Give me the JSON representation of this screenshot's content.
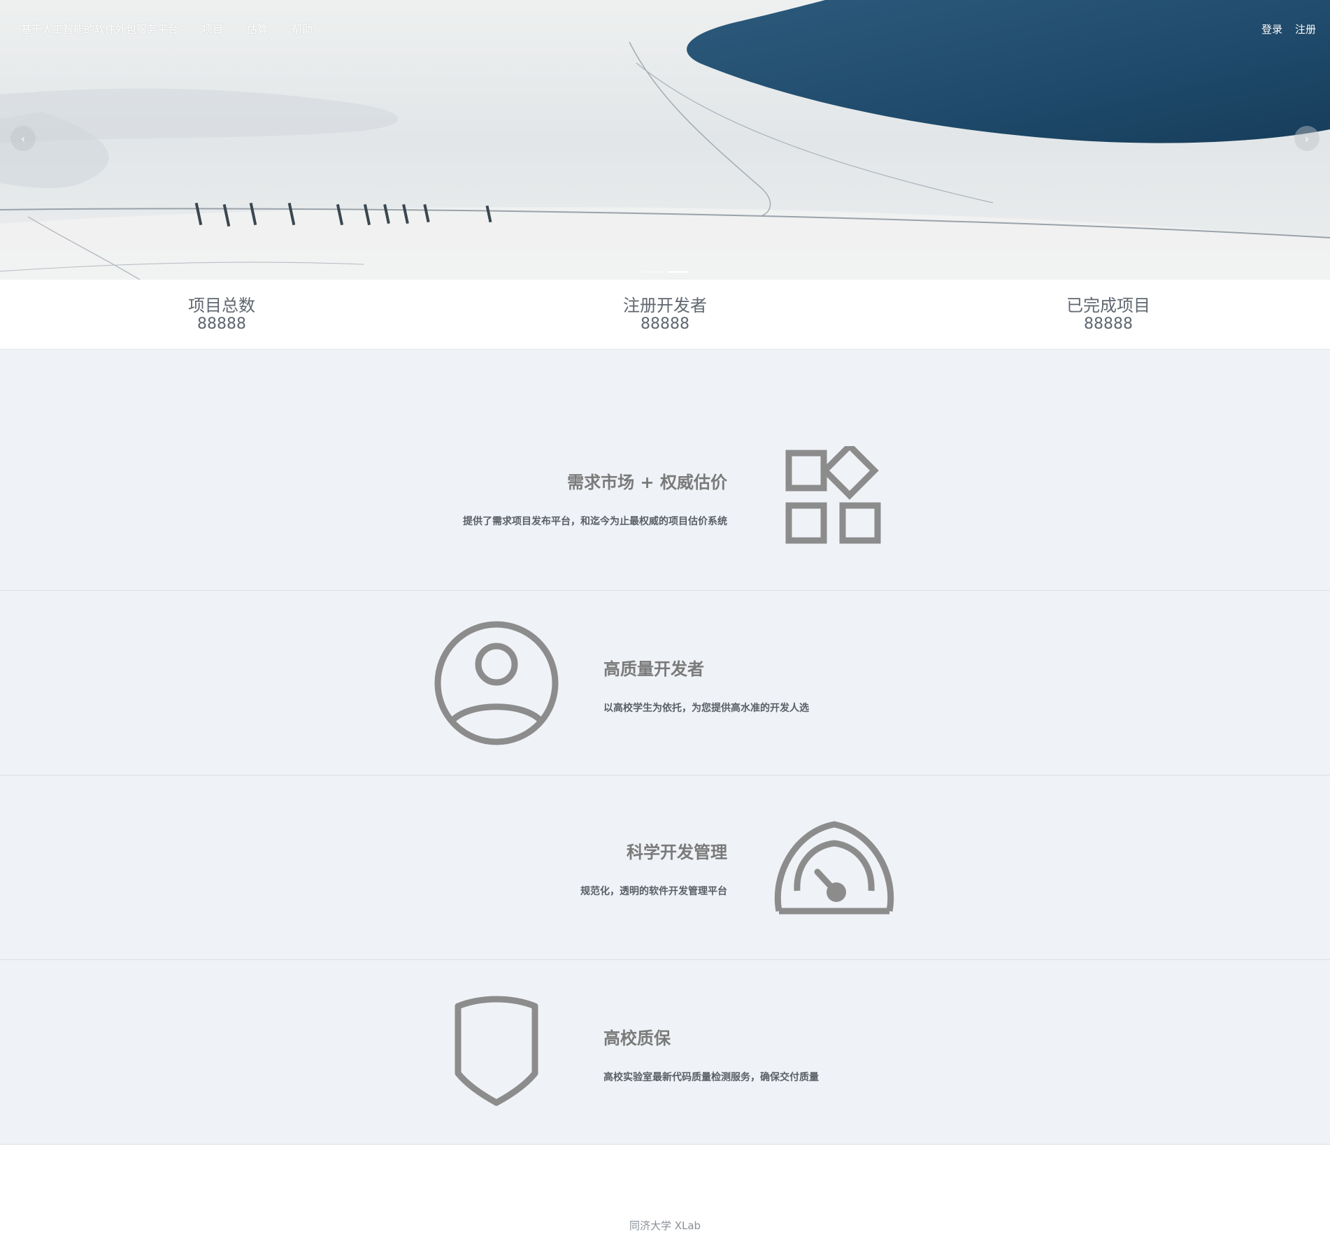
{
  "nav": {
    "brand": "基于人工智能的软件外包服务平台",
    "links": [
      "项目",
      "估算",
      "帮助"
    ],
    "login": "登录",
    "register": "注册"
  },
  "carousel": {
    "prev_symbol": "‹",
    "next_symbol": "›",
    "slide_count": 2,
    "active_index": 1
  },
  "stats": [
    {
      "label": "项目总数",
      "value": "88888"
    },
    {
      "label": "注册开发者",
      "value": "88888"
    },
    {
      "label": "已完成项目",
      "value": "88888"
    }
  ],
  "features": [
    {
      "title": "需求市场 + 权威估价",
      "desc": "提供了需求项目发布平台，和迄今为止最权威的项目估价系统",
      "icon": "apps-icon"
    },
    {
      "title": "高质量开发者",
      "desc": "以高校学生为依托，为您提供高水准的开发人选",
      "icon": "user-circle-icon"
    },
    {
      "title": "科学开发管理",
      "desc": "规范化，透明的软件开发管理平台",
      "icon": "dashboard-icon"
    },
    {
      "title": "高校质保",
      "desc": "高校实验室最新代码质量检测服务，确保交付质量",
      "icon": "shield-icon"
    }
  ],
  "footer": {
    "text": "同济大学 XLab"
  },
  "colors": {
    "feature_bg": "#eff2f6",
    "icon_gray": "#8c8c8c",
    "water_dark": "#1f4a6b"
  }
}
